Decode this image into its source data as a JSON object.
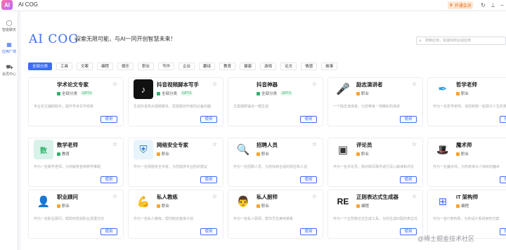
{
  "app": {
    "logo_text": "AI",
    "title": "AI COG"
  },
  "topbar": {
    "vip_label": "开通会员",
    "icons": [
      "refresh-icon",
      "pin-icon",
      "minimize-icon"
    ]
  },
  "sidebar": {
    "items": [
      {
        "label": "智能聊天",
        "icon": "chat-icon"
      },
      {
        "label": "应用广场",
        "icon": "grid-icon",
        "active": true
      },
      {
        "label": "会员中心",
        "icon": "cart-icon"
      }
    ]
  },
  "header": {
    "brand": "AI COG",
    "slogan": "探索无限可能，与AI一同开创智慧未来！",
    "search_placeholder": "搜索应用，快速找到合适应用"
  },
  "tabs": [
    "全部分类",
    "工具",
    "文案",
    "编程",
    "娱乐",
    "职业",
    "写作",
    "企业",
    "翻译",
    "教育",
    "健康",
    "游戏",
    "论文",
    "情感",
    "故事"
  ],
  "use_label": "使用",
  "cards": [
    {
      "title": "学术论文专家",
      "category": "全部分类",
      "badge": "GPT3",
      "cat_color": "green",
      "desc": "专业论文辅助助手，提升学术写作效率",
      "thumb": "blank"
    },
    {
      "title": "抖音视频脚本写手",
      "category": "全部分类",
      "badge": "GPT3",
      "cat_color": "green",
      "desc": "生成抖音热点视频脚本，短视频创作者的必备利器",
      "thumb": "douyin"
    },
    {
      "title": "抖音神器",
      "category": "全部分类",
      "badge": "GPT3",
      "cat_color": "green",
      "desc": "文案爆款输出一键生成",
      "thumb": "blank"
    },
    {
      "title": "励志演讲者",
      "category": "职业",
      "badge": "",
      "cat_color": "orange",
      "desc": "一个励志演讲者，为您带来一场精彩的演讲",
      "thumb": "speech"
    },
    {
      "title": "哲学老师",
      "category": "职业",
      "badge": "",
      "cat_color": "orange",
      "desc": "作为一名哲学老师，请您和我一起探讨人生的意义",
      "thumb": "quill"
    },
    {
      "title": "数学老师",
      "category": "教育",
      "badge": "",
      "cat_color": "green",
      "desc": "作为一名数学老师，为你解答各种数学难题",
      "thumb": "math"
    },
    {
      "title": "网络安全专家",
      "category": "职业",
      "badge": "",
      "cat_color": "orange",
      "desc": "作为一名网络安全专家，为您提供专业防护建议",
      "thumb": "shield"
    },
    {
      "title": "招聘人员",
      "category": "职业",
      "badge": "",
      "cat_color": "orange",
      "desc": "作为一名招聘人员，为您找到合适的岗位和人选",
      "thumb": "recruit"
    },
    {
      "title": "评论员",
      "category": "职业",
      "badge": "",
      "cat_color": "orange",
      "desc": "作为一名评论员，我对新闻事件进行深入解读和评论",
      "thumb": "critic"
    },
    {
      "title": "魔术师",
      "category": "职业",
      "badge": "",
      "cat_color": "orange",
      "desc": "作为一名魔术师，为你表演令人惊叹的魔术",
      "thumb": "magic"
    },
    {
      "title": "职业顾问",
      "category": "职业",
      "badge": "",
      "cat_color": "orange",
      "desc": "作为一名职业顾问，帮助你规划职业发展方向",
      "thumb": "advisor"
    },
    {
      "title": "私人教练",
      "category": "职业",
      "badge": "",
      "cat_color": "orange",
      "desc": "作为一名私人教练，帮你制定健身计划",
      "thumb": "trainer"
    },
    {
      "title": "私人厨师",
      "category": "职业",
      "badge": "",
      "cat_color": "orange",
      "desc": "作为一名私人厨师，帮你烹饪美味菜肴",
      "thumb": "chef"
    },
    {
      "title": "正则表达式生成器",
      "category": "编程",
      "badge": "",
      "cat_color": "orange",
      "desc": "作为一个正则表达式生成工具，为你生成匹配的表达式",
      "thumb": "regex"
    },
    {
      "title": "IT 架构师",
      "category": "编程",
      "badge": "",
      "cat_color": "orange",
      "desc": "作为一名IT架构师，为你设计系统架构方案",
      "thumb": "arch"
    }
  ],
  "watermark": "@稀土掘金技术社区"
}
